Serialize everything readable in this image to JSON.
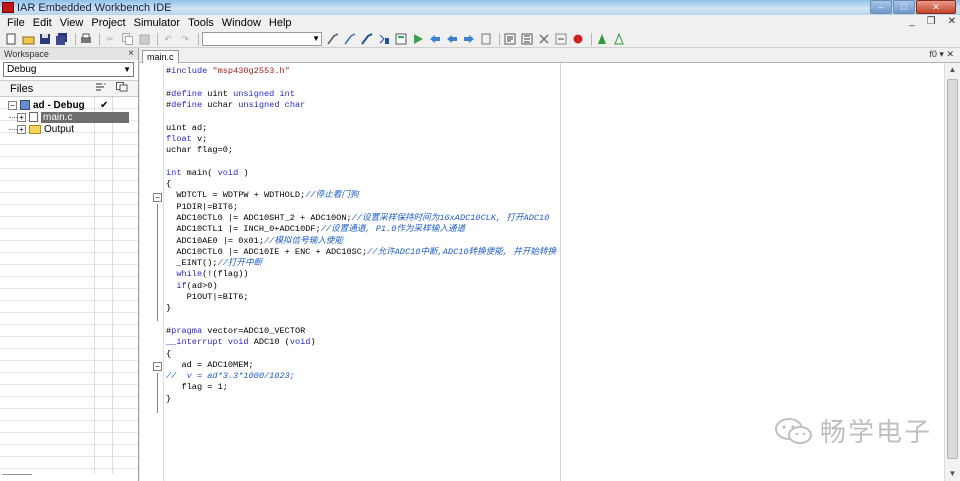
{
  "window": {
    "title": "IAR Embedded Workbench IDE",
    "min_label": "–",
    "max_label": "□",
    "close_label": "✕"
  },
  "menu": [
    "File",
    "Edit",
    "View",
    "Project",
    "Simulator",
    "Tools",
    "Window",
    "Help"
  ],
  "mdi": {
    "min": "_",
    "restore": "❐",
    "close": "✕"
  },
  "toolbar": {
    "find_value": "",
    "buttons": [
      "new-icon",
      "open-icon",
      "save-icon",
      "save-all-icon",
      "print-icon",
      "cut-icon",
      "copy-icon",
      "paste-icon",
      "undo-icon",
      "redo-icon",
      "find-combo",
      "find-icon",
      "find-next-icon",
      "replace-icon",
      "goto-icon",
      "bookmark-icon",
      "bookmark-next-icon",
      "bookmark-prev-icon",
      "bookmark-clear-icon",
      "compile-icon",
      "make-icon",
      "stop-build-icon",
      "toggle-breakpoint-icon",
      "download-debug-icon",
      "debug-without-download-icon"
    ]
  },
  "workspace": {
    "header": "Workspace",
    "close": "×",
    "config": "Debug",
    "files_label": "Files",
    "col1_icon": "build-options-icon",
    "col2_icon": "compile-status-icon",
    "tree": [
      {
        "label": "ad - Debug",
        "check": "✔",
        "level": 0,
        "type": "project",
        "expander": "⊟"
      },
      {
        "label": "main.c",
        "level": 1,
        "type": "file",
        "expander": "⊞",
        "selected": true
      },
      {
        "label": "Output",
        "level": 1,
        "type": "folder",
        "expander": "⊞"
      }
    ]
  },
  "editor": {
    "tab": "main.c",
    "right_label": "f0 ▾ ✕",
    "code": [
      "#include \"msp430g2553.h\"",
      "",
      "#define uint unsigned int",
      "#define uchar unsigned char",
      "",
      "uint ad;",
      "float v;",
      "uchar flag=0;",
      "",
      "int main( void )",
      "{",
      "  WDTCTL = WDTPW + WDTHOLD;//停止看门狗",
      "  P1DIR|=BIT6;",
      "  ADC10CTL0 |= ADC10SHT_2 + ADC10ON;//设置采样保持时间为16xADC10CLK, 打开ADC10",
      "  ADC10CTL1 |= INCH_0+ADC10DF;//设置通道, P1.0作为采样输入通道",
      "  ADC10AE0 |= 0x01;//模拟信号输入使能",
      "  ADC10CTL0 |= ADC10IE + ENC + ADC10SC;//允许ADC10中断,ADC10转换使能, 并开始转换",
      "  _EINT();//打开中断",
      "  while(!(flag))",
      "  if(ad>0)",
      "    P1OUT|=BIT6;",
      "}",
      "",
      "#pragma vector=ADC10_VECTOR",
      "__interrupt void ADC10 (void)",
      "{",
      "   ad = ADC10MEM;",
      "//  v = ad*3.3*1000/1023;",
      "   flag = 1;",
      "}"
    ]
  },
  "watermark": {
    "text": "畅学电子"
  }
}
